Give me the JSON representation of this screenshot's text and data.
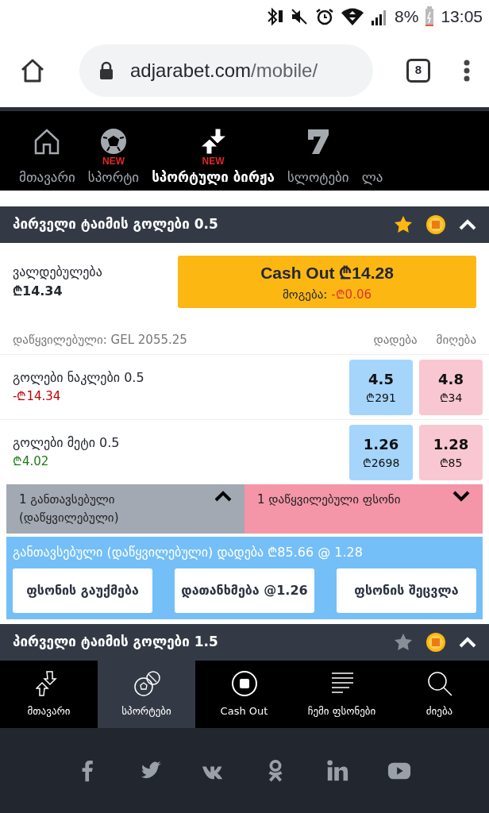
{
  "status_bar": {
    "battery": "8%",
    "time": "13:05"
  },
  "browser": {
    "host": "adjarabet.com",
    "path": "/mobile/",
    "tab_count": "8"
  },
  "top_nav": [
    {
      "label": "მთავარი",
      "selected": false
    },
    {
      "label": "სპორტი",
      "badge": "NEW",
      "selected": false
    },
    {
      "label": "სპორტული ბირჟა",
      "badge": "NEW",
      "selected": true
    },
    {
      "label": "სლოტები",
      "selected": false
    },
    {
      "label": "ლა",
      "selected": false
    }
  ],
  "markets": [
    {
      "title": "პირველი ტაიმის გოლები 0.5",
      "favorite": true,
      "expanded": true,
      "liability_label": "ვალდებულება",
      "liability": "₾14.34",
      "cash_out": "Cash Out ₾14.28",
      "profit_label": "მოგება:",
      "profit": "-₾0.06",
      "matched": "დაწყვილებული: GEL 2055.25",
      "back_label": "დადება",
      "lay_label": "მიღება",
      "selections": [
        {
          "name": "გოლები ნაკლები 0.5",
          "pl": "-₾14.34",
          "kind": "loss",
          "back_odds": "4.5",
          "back_amount": "₾291",
          "lay_odds": "4.8",
          "lay_amount": "₾34"
        },
        {
          "name": "გოლები მეტი 0.5",
          "pl": "₾4.02",
          "kind": "gain",
          "back_odds": "1.26",
          "back_amount": "₾2698",
          "lay_odds": "1.28",
          "lay_amount": "₾85"
        }
      ],
      "toggles": [
        {
          "label": "1 განთავსებული (დაწყვილებული)",
          "expanded": true
        },
        {
          "label": "1 დაწყვილებული ფსონი",
          "expanded": false
        }
      ],
      "bet_panel": {
        "text": "განთავსებული (დაწყვილებული) დადება ₾85.66 @ 1.28",
        "buttons": [
          "ფსონის გაუქმება",
          "დათანხმება @1.26",
          "ფსონის შეცვლა"
        ]
      }
    },
    {
      "title": "პირველი ტაიმის გოლები 1.5",
      "favorite": false,
      "expanded": true
    }
  ],
  "bottom_nav": [
    {
      "label": "მთავარი",
      "selected": false
    },
    {
      "label": "სპორტები",
      "selected": true
    },
    {
      "label": "Cash Out",
      "selected": false
    },
    {
      "label": "ჩემი ფსონები",
      "selected": false
    },
    {
      "label": "ძიება",
      "selected": false
    }
  ]
}
